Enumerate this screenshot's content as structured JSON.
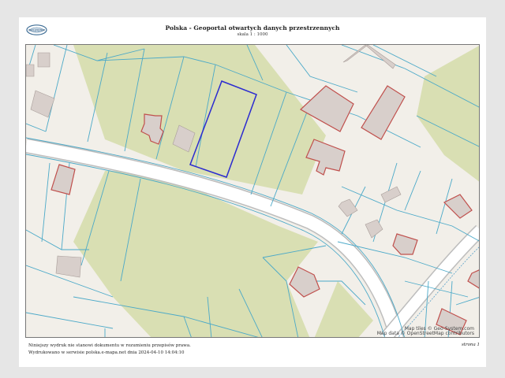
{
  "header": {
    "logo_text": "GEO-SYSTEM",
    "title": "Polska - Geoportal otwartych danych przestrzennych",
    "scale": "skala 1 : 1000"
  },
  "map": {
    "attribution": [
      "Map tiles © Geo-System.com",
      "Map data © OpenStreetMap contributors"
    ],
    "colors": {
      "background": "#f2efe9",
      "vegetation": "#d9dfb3",
      "road": "#ffffff",
      "parcel_border": "#4ba9c8",
      "building_fill": "#d8cfcb",
      "building_outline_red": "#c0504d",
      "selection": "#2b2bd0"
    }
  },
  "footer": {
    "line1": "Niniejszy wydruk nie stanowi dokumentu w rozumieniu przepisów prawa.",
    "line2": "Wydrukowano w serwisie polska.e-mapa.net dnia 2024-04-10 14:04:10",
    "page": "strona 1"
  }
}
